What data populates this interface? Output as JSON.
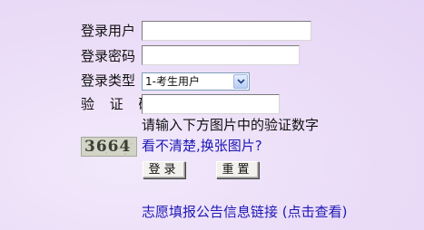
{
  "form": {
    "username_label": "登录用户",
    "username_value": "",
    "password_label": "登录密码",
    "password_value": "",
    "login_type_label": "登录类型",
    "login_type_selected": "1-考生用户",
    "captcha_label": "验 证 码",
    "captcha_value": "",
    "captcha_hint": "请输入下方图片中的验证数字",
    "captcha_image_text": "3664",
    "captcha_refresh_link": "看不清楚,换张图片?",
    "login_button": "登录",
    "reset_button": "重置"
  },
  "footer": {
    "info_link": "志愿填报公告信息链接 (点击查看)"
  },
  "icons": {
    "dropdown": "chevron-down-icon"
  },
  "colors": {
    "background": "#e9dcf7",
    "link": "#1f18b6",
    "captcha_bg": "#d2d4c6"
  }
}
